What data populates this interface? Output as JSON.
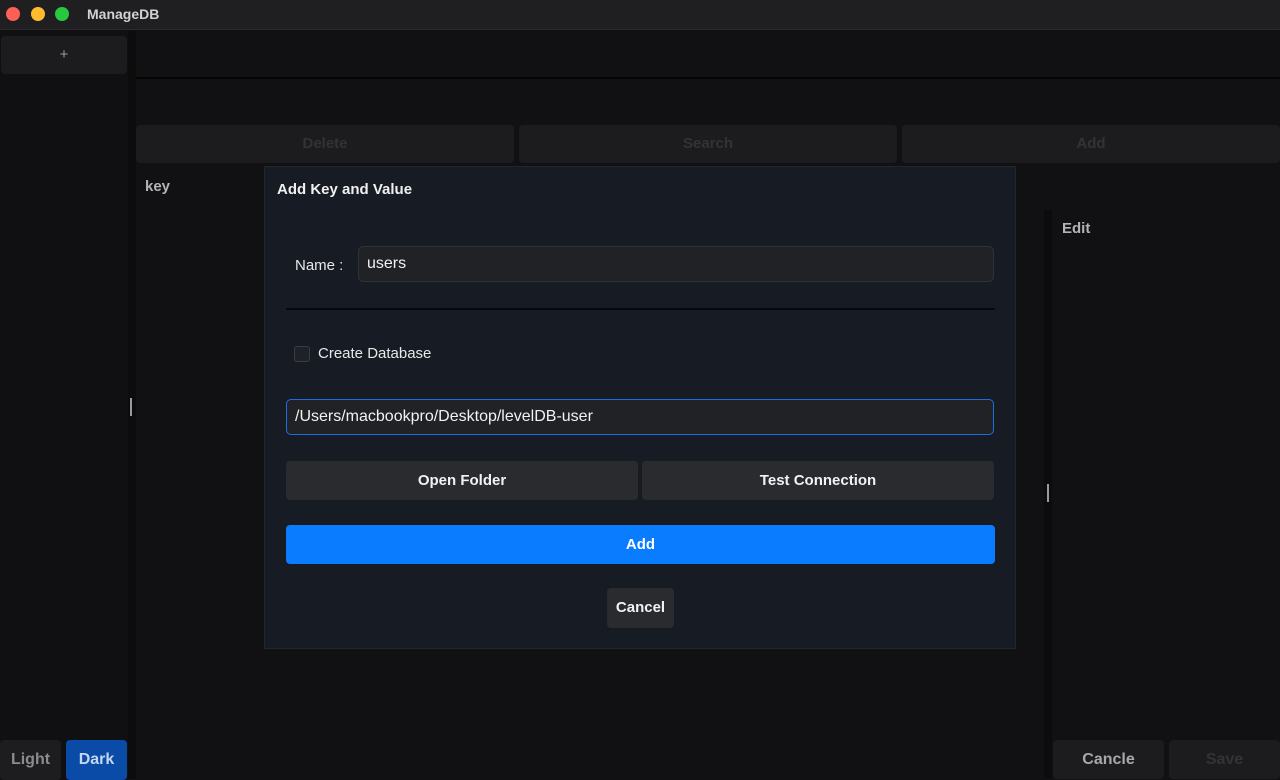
{
  "window": {
    "title": "ManageDB"
  },
  "sidebar": {
    "add_label": "+"
  },
  "theme": {
    "light_label": "Light",
    "dark_label": "Dark",
    "active": "Dark"
  },
  "toolbar": {
    "delete_label": "Delete",
    "search_label": "Search",
    "add_label": "Add"
  },
  "list_panel": {
    "header": "key"
  },
  "edit_panel": {
    "header": "Edit",
    "cancel_label": "Cancle",
    "save_label": "Save"
  },
  "dialog": {
    "title": "Add Key and Value",
    "name_label": "Name :",
    "name_value": "users",
    "create_db_label": "Create Database",
    "create_db_checked": false,
    "path_value": "/Users/macbookpro/Desktop/levelDB-user",
    "open_folder_label": "Open Folder",
    "test_connection_label": "Test Connection",
    "add_label": "Add",
    "cancel_label": "Cancel"
  },
  "colors": {
    "accent": "#0a7cff",
    "dark_theme_active": "#0a4ba8",
    "dialog_bg": "#171b24"
  },
  "icons": {
    "window_controls": [
      "close",
      "minimize",
      "maximize"
    ]
  }
}
